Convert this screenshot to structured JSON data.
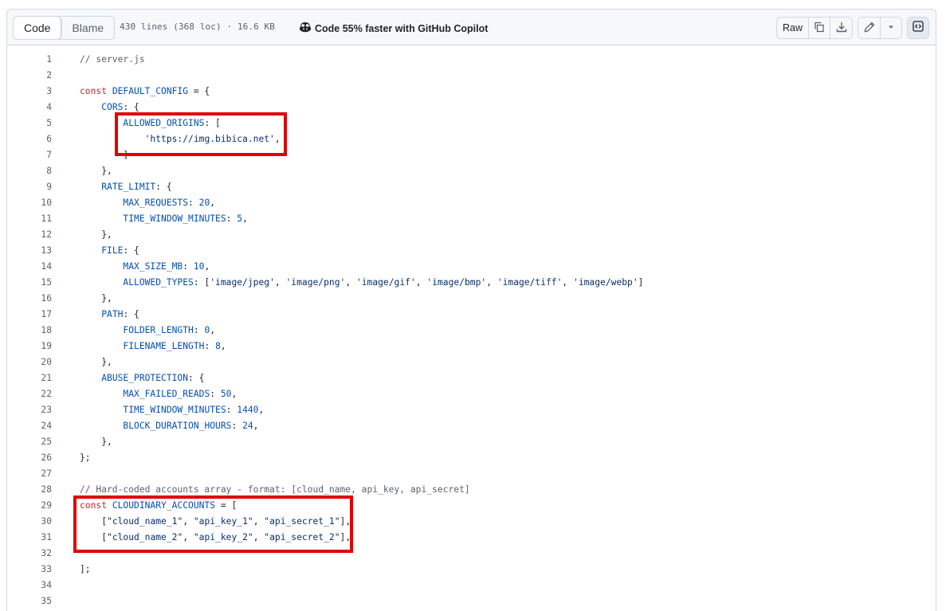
{
  "toolbar": {
    "code_tab": "Code",
    "blame_tab": "Blame",
    "file_info": "430 lines (368 loc) · 16.6 KB",
    "copilot_text": "Code 55% faster with GitHub Copilot",
    "raw_label": "Raw"
  },
  "lines": [
    {
      "n": "1",
      "indent": "",
      "tokens": [
        {
          "t": "// server.js",
          "c": "com"
        }
      ]
    },
    {
      "n": "2",
      "indent": "",
      "tokens": []
    },
    {
      "n": "3",
      "indent": "",
      "tokens": [
        {
          "t": "const ",
          "c": "kw"
        },
        {
          "t": "DEFAULT_CONFIG",
          "c": "id"
        },
        {
          "t": " = {",
          "c": ""
        }
      ]
    },
    {
      "n": "4",
      "indent": "    ",
      "tokens": [
        {
          "t": "CORS",
          "c": "id"
        },
        {
          "t": ": {",
          "c": ""
        }
      ]
    },
    {
      "n": "5",
      "indent": "        ",
      "tokens": [
        {
          "t": "ALLOWED_ORIGINS",
          "c": "id"
        },
        {
          "t": ": [",
          "c": ""
        }
      ]
    },
    {
      "n": "6",
      "indent": "            ",
      "tokens": [
        {
          "t": "'https://img.bibica.net'",
          "c": "str"
        },
        {
          "t": ",",
          "c": ""
        }
      ]
    },
    {
      "n": "7",
      "indent": "        ",
      "tokens": [
        {
          "t": "]",
          "c": ""
        }
      ]
    },
    {
      "n": "8",
      "indent": "    ",
      "tokens": [
        {
          "t": "},",
          "c": ""
        }
      ]
    },
    {
      "n": "9",
      "indent": "    ",
      "tokens": [
        {
          "t": "RATE_LIMIT",
          "c": "id"
        },
        {
          "t": ": {",
          "c": ""
        }
      ]
    },
    {
      "n": "10",
      "indent": "        ",
      "tokens": [
        {
          "t": "MAX_REQUESTS",
          "c": "id"
        },
        {
          "t": ": ",
          "c": ""
        },
        {
          "t": "20",
          "c": "num"
        },
        {
          "t": ",",
          "c": ""
        }
      ]
    },
    {
      "n": "11",
      "indent": "        ",
      "tokens": [
        {
          "t": "TIME_WINDOW_MINUTES",
          "c": "id"
        },
        {
          "t": ": ",
          "c": ""
        },
        {
          "t": "5",
          "c": "num"
        },
        {
          "t": ",",
          "c": ""
        }
      ]
    },
    {
      "n": "12",
      "indent": "    ",
      "tokens": [
        {
          "t": "},",
          "c": ""
        }
      ]
    },
    {
      "n": "13",
      "indent": "    ",
      "tokens": [
        {
          "t": "FILE",
          "c": "id"
        },
        {
          "t": ": {",
          "c": ""
        }
      ]
    },
    {
      "n": "14",
      "indent": "        ",
      "tokens": [
        {
          "t": "MAX_SIZE_MB",
          "c": "id"
        },
        {
          "t": ": ",
          "c": ""
        },
        {
          "t": "10",
          "c": "num"
        },
        {
          "t": ",",
          "c": ""
        }
      ]
    },
    {
      "n": "15",
      "indent": "        ",
      "tokens": [
        {
          "t": "ALLOWED_TYPES",
          "c": "id"
        },
        {
          "t": ": [",
          "c": ""
        },
        {
          "t": "'image/jpeg'",
          "c": "str"
        },
        {
          "t": ", ",
          "c": ""
        },
        {
          "t": "'image/png'",
          "c": "str"
        },
        {
          "t": ", ",
          "c": ""
        },
        {
          "t": "'image/gif'",
          "c": "str"
        },
        {
          "t": ", ",
          "c": ""
        },
        {
          "t": "'image/bmp'",
          "c": "str"
        },
        {
          "t": ", ",
          "c": ""
        },
        {
          "t": "'image/tiff'",
          "c": "str"
        },
        {
          "t": ", ",
          "c": ""
        },
        {
          "t": "'image/webp'",
          "c": "str"
        },
        {
          "t": "]",
          "c": ""
        }
      ]
    },
    {
      "n": "16",
      "indent": "    ",
      "tokens": [
        {
          "t": "},",
          "c": ""
        }
      ]
    },
    {
      "n": "17",
      "indent": "    ",
      "tokens": [
        {
          "t": "PATH",
          "c": "id"
        },
        {
          "t": ": {",
          "c": ""
        }
      ]
    },
    {
      "n": "18",
      "indent": "        ",
      "tokens": [
        {
          "t": "FOLDER_LENGTH",
          "c": "id"
        },
        {
          "t": ": ",
          "c": ""
        },
        {
          "t": "0",
          "c": "num"
        },
        {
          "t": ",",
          "c": ""
        }
      ]
    },
    {
      "n": "19",
      "indent": "        ",
      "tokens": [
        {
          "t": "FILENAME_LENGTH",
          "c": "id"
        },
        {
          "t": ": ",
          "c": ""
        },
        {
          "t": "8",
          "c": "num"
        },
        {
          "t": ",",
          "c": ""
        }
      ]
    },
    {
      "n": "20",
      "indent": "    ",
      "tokens": [
        {
          "t": "},",
          "c": ""
        }
      ]
    },
    {
      "n": "21",
      "indent": "    ",
      "tokens": [
        {
          "t": "ABUSE_PROTECTION",
          "c": "id"
        },
        {
          "t": ": {",
          "c": ""
        }
      ]
    },
    {
      "n": "22",
      "indent": "        ",
      "tokens": [
        {
          "t": "MAX_FAILED_READS",
          "c": "id"
        },
        {
          "t": ": ",
          "c": ""
        },
        {
          "t": "50",
          "c": "num"
        },
        {
          "t": ",",
          "c": ""
        }
      ]
    },
    {
      "n": "23",
      "indent": "        ",
      "tokens": [
        {
          "t": "TIME_WINDOW_MINUTES",
          "c": "id"
        },
        {
          "t": ": ",
          "c": ""
        },
        {
          "t": "1440",
          "c": "num"
        },
        {
          "t": ",",
          "c": ""
        }
      ]
    },
    {
      "n": "24",
      "indent": "        ",
      "tokens": [
        {
          "t": "BLOCK_DURATION_HOURS",
          "c": "id"
        },
        {
          "t": ": ",
          "c": ""
        },
        {
          "t": "24",
          "c": "num"
        },
        {
          "t": ",",
          "c": ""
        }
      ]
    },
    {
      "n": "25",
      "indent": "    ",
      "tokens": [
        {
          "t": "},",
          "c": ""
        }
      ]
    },
    {
      "n": "26",
      "indent": "",
      "tokens": [
        {
          "t": "};",
          "c": ""
        }
      ]
    },
    {
      "n": "27",
      "indent": "",
      "tokens": []
    },
    {
      "n": "28",
      "indent": "",
      "tokens": [
        {
          "t": "// Hard-coded accounts array - format: [cloud_name, api_key, api_secret]",
          "c": "com"
        }
      ]
    },
    {
      "n": "29",
      "indent": "",
      "tokens": [
        {
          "t": "const ",
          "c": "kw"
        },
        {
          "t": "CLOUDINARY_ACCOUNTS",
          "c": "id"
        },
        {
          "t": " = [",
          "c": ""
        }
      ]
    },
    {
      "n": "30",
      "indent": "    ",
      "tokens": [
        {
          "t": "[",
          "c": ""
        },
        {
          "t": "\"cloud_name_1\"",
          "c": "str"
        },
        {
          "t": ", ",
          "c": ""
        },
        {
          "t": "\"api_key_1\"",
          "c": "str"
        },
        {
          "t": ", ",
          "c": ""
        },
        {
          "t": "\"api_secret_1\"",
          "c": "str"
        },
        {
          "t": "],",
          "c": ""
        }
      ]
    },
    {
      "n": "31",
      "indent": "    ",
      "tokens": [
        {
          "t": "[",
          "c": ""
        },
        {
          "t": "\"cloud_name_2\"",
          "c": "str"
        },
        {
          "t": ", ",
          "c": ""
        },
        {
          "t": "\"api_key_2\"",
          "c": "str"
        },
        {
          "t": ", ",
          "c": ""
        },
        {
          "t": "\"api_secret_2\"",
          "c": "str"
        },
        {
          "t": "],",
          "c": ""
        }
      ]
    },
    {
      "n": "32",
      "indent": "",
      "tokens": []
    },
    {
      "n": "33",
      "indent": "",
      "tokens": [
        {
          "t": "];",
          "c": ""
        }
      ]
    },
    {
      "n": "34",
      "indent": "",
      "tokens": []
    },
    {
      "n": "35",
      "indent": "",
      "tokens": []
    }
  ],
  "colors": {
    "highlight_box": "#e00000",
    "keyword": "#cf222e",
    "identifier": "#0550ae",
    "string": "#0a3069",
    "comment": "#59636e"
  }
}
